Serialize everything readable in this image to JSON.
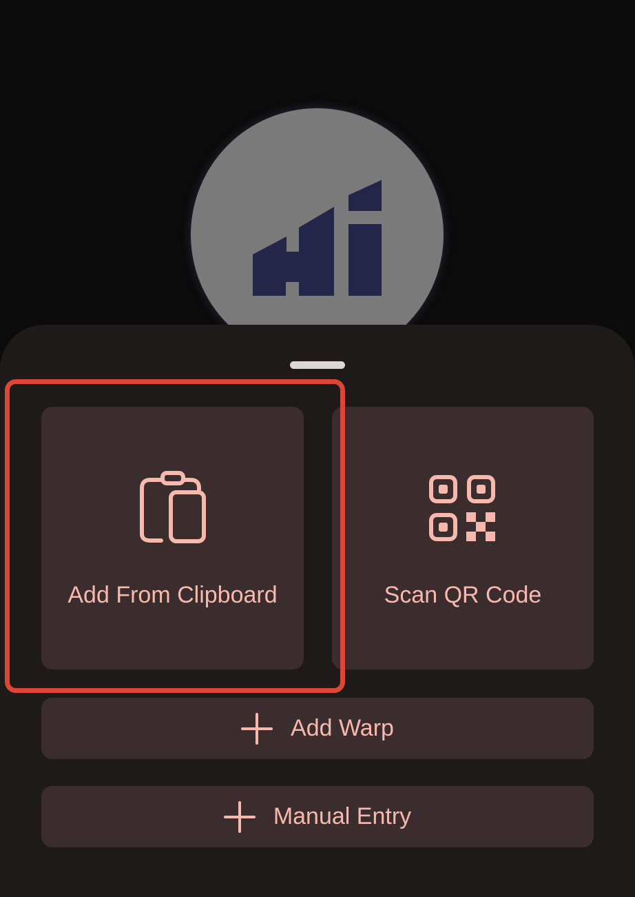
{
  "sheet": {
    "tiles": [
      {
        "label": "Add From Clipboard",
        "icon": "clipboard-icon",
        "highlighted": true
      },
      {
        "label": "Scan QR Code",
        "icon": "qr-code-icon",
        "highlighted": false
      }
    ],
    "buttons": [
      {
        "label": "Add Warp",
        "icon": "plus-icon"
      },
      {
        "label": "Manual Entry",
        "icon": "plus-icon"
      }
    ]
  },
  "colors": {
    "background": "#0c0b0b",
    "sheet": "#1f1a1a",
    "tile": "#3b2d2d",
    "accent_text": "#f7b9ad",
    "highlight": "#dd4536",
    "logo_circle": "#7a7a7a",
    "logo_mark": "#232648"
  }
}
